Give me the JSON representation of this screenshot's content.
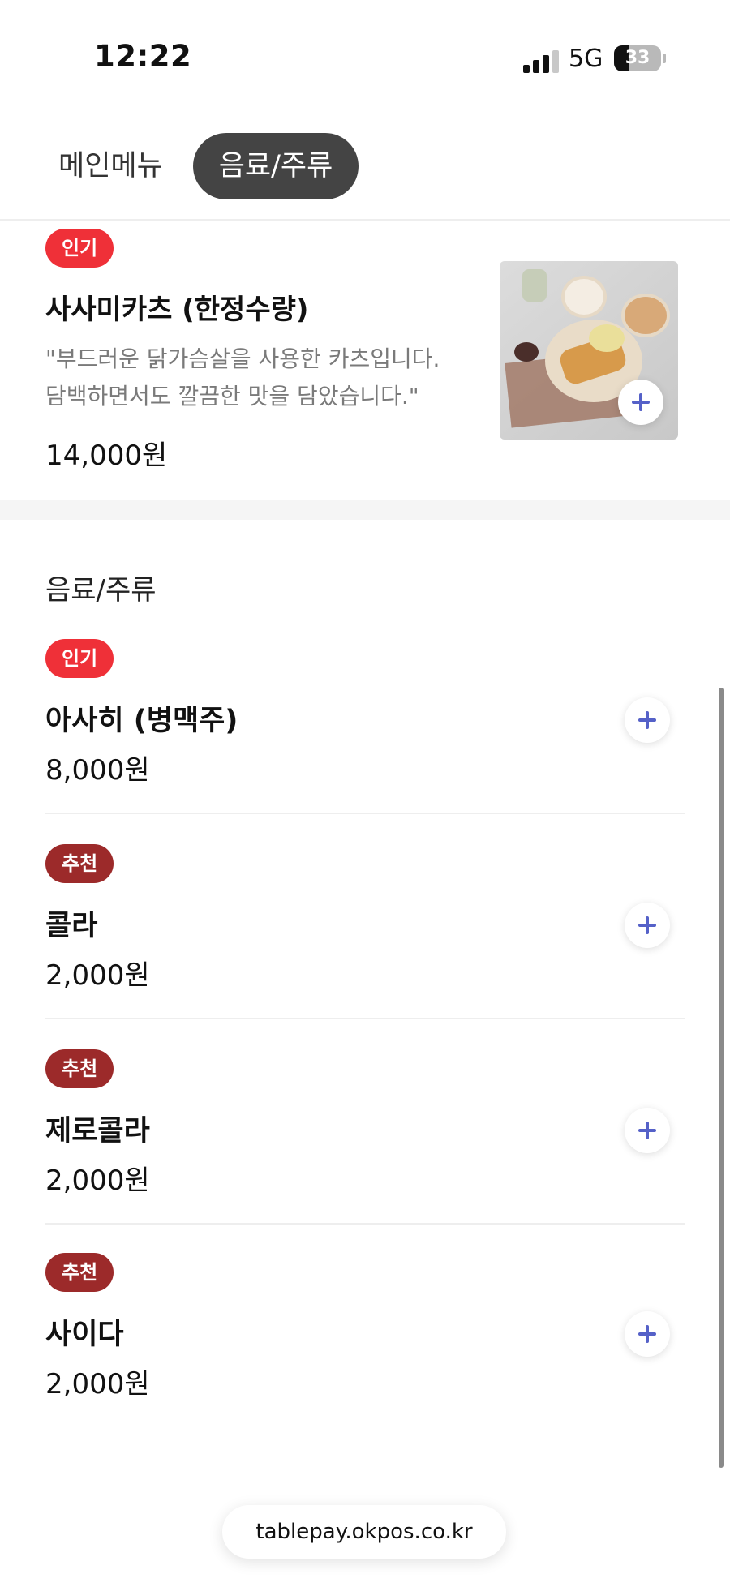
{
  "status_bar": {
    "time": "12:22",
    "network": "5G",
    "battery_percent": "33",
    "battery_level": 0.33
  },
  "tabs": [
    {
      "label": "메인메뉴",
      "active": false
    },
    {
      "label": "음료/주류",
      "active": true
    }
  ],
  "featured_item": {
    "badge": "인기",
    "name": "사사미카츠 (한정수량)",
    "description_line1": "\"부드러운 닭가슴살을 사용한 카츠입니다.",
    "description_line2": "담백하면서도 깔끔한 맛을 담았습니다.\"",
    "price": "14,000원",
    "image_icon": "food-photo",
    "add_icon": "plus-icon"
  },
  "section": {
    "title": "음료/주류",
    "items": [
      {
        "badge": "인기",
        "badge_type": "popular",
        "name": "아사히 (병맥주)",
        "price": "8,000원"
      },
      {
        "badge": "추천",
        "badge_type": "recommended",
        "name": "콜라",
        "price": "2,000원"
      },
      {
        "badge": "추천",
        "badge_type": "recommended",
        "name": "제로콜라",
        "price": "2,000원"
      },
      {
        "badge": "추천",
        "badge_type": "recommended",
        "name": "사이다",
        "price": "2,000원"
      }
    ]
  },
  "url_bar": {
    "url": "tablepay.okpos.co.kr"
  },
  "colors": {
    "popular_badge": "#ef3038",
    "recommended_badge": "#9c2a2a",
    "active_tab": "#444444",
    "add_icon": "#5561c8"
  }
}
